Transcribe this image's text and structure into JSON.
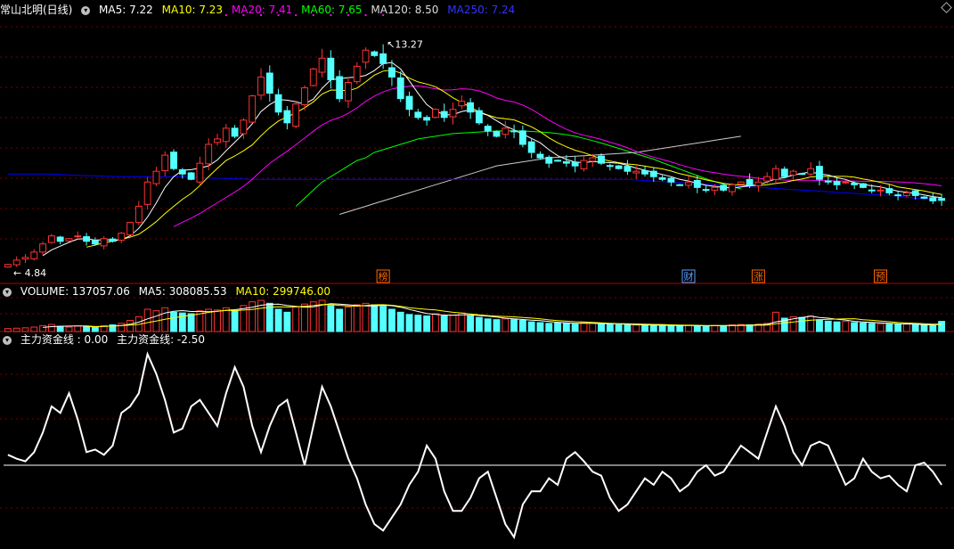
{
  "window": {
    "title": "常山北明(日线)"
  },
  "colors": {
    "up": "#ff3232",
    "down": "#54ffff",
    "ma5": "#ffffff",
    "ma10": "#ffff00",
    "ma20": "#ff00ff",
    "ma60": "#00ff00",
    "ma120": "#cccccc",
    "ma250": "#0000ff",
    "panel_line": "#b00000",
    "grid": "#7a0000"
  },
  "main_legend": {
    "ma5": "MA5: 7.22",
    "ma10": "MA10: 7.23",
    "ma20": "MA20: 7.41",
    "ma60": "MA60: 7.65",
    "ma120": "MA120: 8.50",
    "ma250": "MA250: 7.24"
  },
  "volume_legend": {
    "volume": "VOLUME: 137057.06",
    "ma5": "MA5: 308085.53",
    "ma10": "MA10: 299746.00"
  },
  "indicator_legend": {
    "line1": "主力资金线 : 0.00",
    "line2": "主力资金线: -2.50"
  },
  "annotations": {
    "high": "13.27",
    "low": "4.84"
  },
  "markers": [
    {
      "label": "榜",
      "index": 43,
      "color": "#ff6a00"
    },
    {
      "label": "财",
      "index": 78,
      "color": "#5aa0ff"
    },
    {
      "label": "涨",
      "index": 86,
      "color": "#ff6a00"
    },
    {
      "label": "预",
      "index": 100,
      "color": "#ff6a00"
    }
  ],
  "chart_data": [
    {
      "type": "candlestick",
      "ylim": [
        4.4,
        14.0
      ],
      "grid": true,
      "series_close": [
        4.84,
        5.0,
        5.1,
        5.3,
        5.6,
        5.9,
        5.7,
        5.8,
        5.9,
        5.7,
        5.6,
        5.8,
        5.7,
        6.0,
        6.4,
        7.0,
        7.9,
        8.3,
        8.9,
        8.4,
        8.2,
        8.0,
        8.6,
        9.3,
        9.5,
        9.9,
        9.6,
        10.2,
        11.1,
        11.8,
        11.2,
        10.5,
        10.1,
        10.8,
        11.4,
        12.1,
        12.5,
        11.7,
        11.0,
        11.6,
        12.2,
        12.8,
        12.6,
        12.3,
        11.8,
        11.0,
        10.6,
        10.3,
        10.2,
        10.6,
        10.3,
        10.6,
        10.9,
        10.5,
        10.1,
        9.8,
        9.6,
        9.9,
        9.8,
        9.3,
        9.0,
        8.8,
        8.6,
        8.7,
        8.6,
        8.5,
        8.7,
        8.8,
        8.6,
        8.5,
        8.4,
        8.3,
        8.3,
        8.2,
        8.1,
        8.0,
        7.9,
        7.8,
        7.9,
        7.7,
        7.6,
        7.7,
        7.6,
        7.8,
        7.9,
        7.8,
        7.9,
        8.1,
        8.4,
        8.1,
        8.3,
        8.2,
        8.4,
        8.0,
        7.9,
        7.8,
        7.9,
        7.8,
        7.7,
        7.6,
        7.6,
        7.5,
        7.4,
        7.5,
        7.4,
        7.3,
        7.2,
        7.22
      ],
      "ma_series": [
        {
          "name": "MA60",
          "color": "#00ff00",
          "start": 33,
          "values": [
            7.0,
            7.3,
            7.6,
            7.9,
            8.1,
            8.3,
            8.5,
            8.7,
            8.8,
            9.0,
            9.1,
            9.2,
            9.3,
            9.4,
            9.5,
            9.55,
            9.6,
            9.65,
            9.7,
            9.72,
            9.74,
            9.76,
            9.78,
            9.8,
            9.8,
            9.8,
            9.8,
            9.78,
            9.76,
            9.74,
            9.7,
            9.66,
            9.6,
            9.52,
            9.44,
            9.35,
            9.25,
            9.15,
            9.05,
            8.95,
            8.85,
            8.75,
            8.62,
            8.5,
            8.38,
            8.26,
            8.14,
            8.02,
            7.92,
            7.82,
            7.72,
            7.65
          ]
        },
        {
          "name": "MA120",
          "color": "#cccccc",
          "start": 38,
          "values": [
            6.7,
            6.8,
            6.9,
            7.0,
            7.1,
            7.2,
            7.3,
            7.4,
            7.5,
            7.6,
            7.7,
            7.8,
            7.9,
            8.0,
            8.1,
            8.2,
            8.3,
            8.4,
            8.5,
            8.55,
            8.6,
            8.65,
            8.7,
            8.75,
            8.8,
            8.82,
            8.84,
            8.86,
            8.88,
            8.9,
            8.92,
            8.94,
            8.96,
            8.98,
            9.0,
            9.05,
            9.1,
            9.15,
            9.2,
            9.25,
            9.3,
            9.35,
            9.4,
            9.45,
            9.5,
            9.55,
            9.6
          ]
        },
        {
          "name": "MA250",
          "color": "#0000ff",
          "start": 0,
          "values": [
            8.2,
            8.2,
            8.2,
            8.2,
            8.2,
            8.2,
            8.18,
            8.16,
            8.15,
            8.14,
            8.13,
            8.12,
            8.11,
            8.1,
            8.1,
            8.1,
            8.1,
            8.1,
            8.1,
            8.1,
            8.1,
            8.08,
            8.06,
            8.05,
            8.04,
            8.03,
            8.02,
            8.01,
            8.0,
            8.0,
            8.0,
            8.0,
            8.0,
            8.0,
            8.0,
            8.0,
            8.0,
            8.0,
            8.0,
            8.0,
            8.0,
            8.0,
            8.0,
            8.0,
            8.0,
            8.0,
            8.0,
            8.0,
            8.0,
            8.0,
            8.0,
            8.0,
            8.0,
            8.0,
            8.0,
            8.0,
            8.0,
            8.0,
            8.0,
            8.0,
            8.0,
            8.0,
            8.0,
            8.0,
            8.0,
            8.0,
            8.0,
            8.0,
            8.0,
            8.0,
            8.0,
            8.0,
            7.98,
            7.96,
            7.94,
            7.92,
            7.9,
            7.88,
            7.86,
            7.84,
            7.82,
            7.8,
            7.78,
            7.76,
            7.74,
            7.72,
            7.7,
            7.68,
            7.66,
            7.64,
            7.62,
            7.6,
            7.58,
            7.56,
            7.54,
            7.52,
            7.5,
            7.48,
            7.46,
            7.44,
            7.42,
            7.4,
            7.38,
            7.34,
            7.3,
            7.27,
            7.25,
            7.24
          ]
        }
      ]
    },
    {
      "type": "bar",
      "title": "VOLUME",
      "values": [
        40,
        45,
        50,
        60,
        80,
        95,
        70,
        60,
        75,
        70,
        60,
        80,
        90,
        110,
        150,
        200,
        300,
        280,
        320,
        260,
        250,
        240,
        280,
        300,
        290,
        320,
        280,
        350,
        400,
        420,
        380,
        300,
        260,
        330,
        370,
        400,
        420,
        350,
        300,
        330,
        360,
        380,
        360,
        340,
        300,
        260,
        230,
        220,
        210,
        240,
        210,
        220,
        250,
        210,
        190,
        170,
        160,
        170,
        160,
        150,
        130,
        120,
        110,
        115,
        110,
        100,
        120,
        110,
        100,
        95,
        90,
        90,
        88,
        86,
        84,
        80,
        78,
        76,
        85,
        78,
        75,
        80,
        78,
        90,
        95,
        90,
        100,
        110,
        260,
        180,
        200,
        190,
        210,
        160,
        140,
        130,
        135,
        120,
        115,
        110,
        105,
        100,
        95,
        100,
        90,
        85,
        80,
        137
      ]
    },
    {
      "type": "line",
      "title": "主力资金线",
      "zero_line": 0,
      "ylim": [
        -6,
        9
      ],
      "values": [
        0.8,
        0.5,
        0.3,
        1.0,
        2.5,
        4.5,
        4.0,
        5.5,
        3.5,
        1.0,
        1.2,
        0.8,
        1.5,
        4.0,
        4.5,
        5.5,
        8.5,
        7.0,
        5.0,
        2.5,
        2.8,
        4.5,
        5.0,
        4.0,
        3.0,
        5.5,
        7.5,
        6.0,
        3.0,
        1.0,
        3.0,
        4.5,
        5.0,
        2.5,
        0.0,
        3.0,
        6.0,
        4.5,
        2.5,
        0.5,
        -1.0,
        -3.0,
        -4.5,
        -5.0,
        -4.0,
        -3.0,
        -1.5,
        -0.5,
        1.5,
        0.5,
        -2.0,
        -3.5,
        -3.5,
        -2.5,
        -1.0,
        -0.5,
        -2.5,
        -4.5,
        -5.5,
        -3.0,
        -2.0,
        -2.0,
        -1.0,
        -1.5,
        0.5,
        1.0,
        0.3,
        -0.5,
        -0.8,
        -2.5,
        -3.5,
        -3.0,
        -2.0,
        -1.0,
        -1.5,
        -0.5,
        -1.0,
        -2.0,
        -1.5,
        -0.5,
        0.0,
        -0.8,
        -0.5,
        0.5,
        1.5,
        1.0,
        0.5,
        2.5,
        4.5,
        3.0,
        1.0,
        0.0,
        1.5,
        1.8,
        1.5,
        0.0,
        -1.5,
        -1.0,
        0.5,
        -0.5,
        -1.0,
        -0.8,
        -1.5,
        -2.0,
        0.0,
        0.2,
        -0.5,
        -1.5
      ]
    }
  ]
}
